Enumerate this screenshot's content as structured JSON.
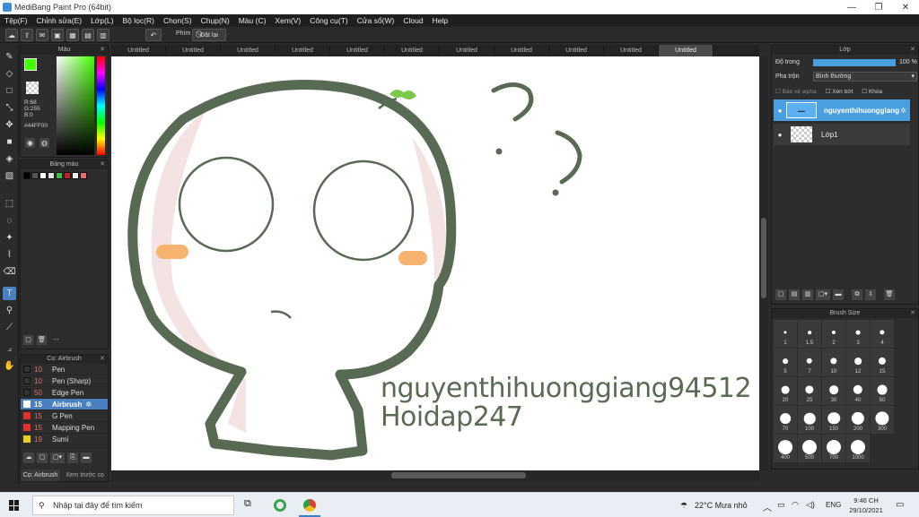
{
  "window": {
    "title": "MediBang Paint Pro (64bit)",
    "minimize": "—",
    "restore": "❐",
    "close": "✕"
  },
  "menu": [
    "Tệp(F)",
    "Chỉnh sửa(E)",
    "Lớp(L)",
    "Bộ lọc(R)",
    "Chọn(S)",
    "Chụp(N)",
    "Màu (C)",
    "Xem(V)",
    "Công cụ(T)",
    "Cửa sổ(W)",
    "Cloud",
    "Help"
  ],
  "toolbar": {
    "shortcut_label": "Phím",
    "reset_label": "Đặt lại"
  },
  "tabs": [
    "Untitled",
    "Untitled",
    "Untitled",
    "Untitled",
    "Untitled",
    "Untitled",
    "Untitled",
    "Untitled",
    "Untitled",
    "Untitled",
    "Untitled"
  ],
  "color_panel": {
    "title": "Màu",
    "r": "R:68",
    "g": "G:255",
    "b": "B:0",
    "hex": "#44FF00",
    "fg": "#44ff00",
    "bg": "#000000"
  },
  "palette_panel": {
    "title": "Bảng màu",
    "swatches": [
      "#000000",
      "#555555",
      "#ffffff",
      "#e0e0e0",
      "#3cc040",
      "#c02020",
      "#f0f0f0",
      "#e07070"
    ],
    "footer_text": "---"
  },
  "brush_panel": {
    "title": "Cọ: Airbrush",
    "items": [
      {
        "size": "10",
        "name": "Pen",
        "color": "#333333"
      },
      {
        "size": "10",
        "name": "Pen (Sharp)",
        "color": "#333333"
      },
      {
        "size": "50",
        "name": "Edge Pen",
        "color": "#333333"
      },
      {
        "size": "15",
        "name": "Airbrush",
        "color": "#ffffff",
        "active": true
      },
      {
        "size": "15",
        "name": "G Pen",
        "color": "#e03030"
      },
      {
        "size": "15",
        "name": "Mapping Pen",
        "color": "#e03030"
      },
      {
        "size": "19",
        "name": "Sumi",
        "color": "#e8d020"
      }
    ],
    "tab_brush": "Cọ: Airbrush",
    "tab_preview": "Xem trước cọ"
  },
  "layer_panel": {
    "title": "Lớp",
    "opacity_label": "Độ trong",
    "opacity_value": "100 %",
    "opacity": 1.0,
    "blend_label": "Pha trộn",
    "blend_value": "Bình thường",
    "protect_alpha": "Bảo vệ alpha",
    "clipping": "Xén bớt",
    "lock": "Khóa",
    "layers": [
      {
        "name": "nguyenthihuonggiang",
        "active": true
      },
      {
        "name": "Lớp1",
        "active": false
      }
    ]
  },
  "brush_size_panel": {
    "title": "Brush Size",
    "sizes": [
      "1",
      "1.5",
      "2",
      "3",
      "4",
      "5",
      "7",
      "10",
      "12",
      "15",
      "20",
      "25",
      "30",
      "40",
      "50",
      "70",
      "100",
      "150",
      "200",
      "300",
      "400",
      "500",
      "700",
      "1000"
    ]
  },
  "canvas": {
    "text_line1": "nguyenthihuonggiang94512",
    "text_line2": "Hoidap247",
    "text_color": "#5b6a53",
    "stroke_color": "#586a53"
  },
  "taskbar": {
    "search_placeholder": "Nhập tại đây để tìm kiếm",
    "weather": "22°C  Mưa nhỏ",
    "lang": "ENG",
    "time": "9:46 CH",
    "date": "29/10/2021"
  }
}
